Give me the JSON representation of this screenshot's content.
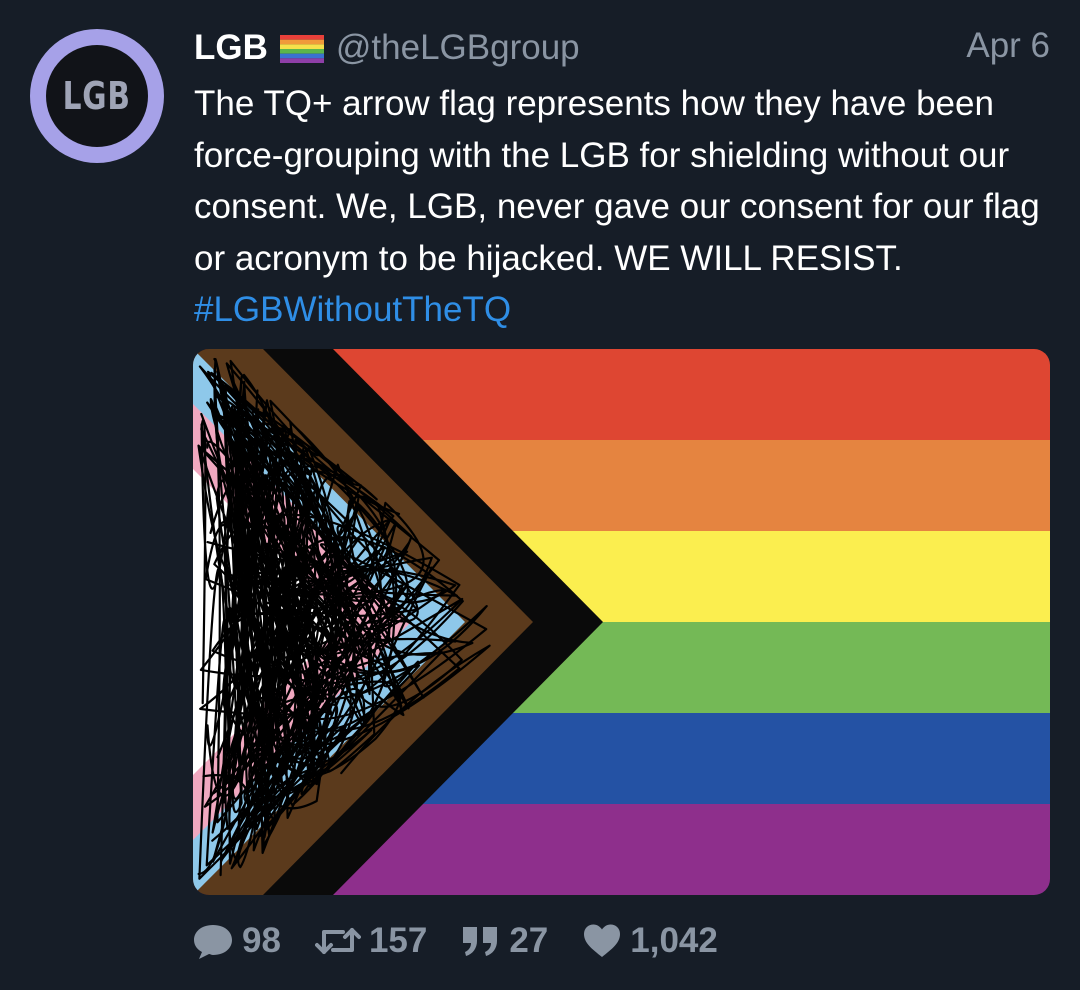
{
  "tweet": {
    "avatar_text": "LGB",
    "display_name": "LGB",
    "name_emoji": "rainbow-flag-icon",
    "handle": "@theLGBgroup",
    "date": "Apr 6",
    "text_main": "The TQ+ arrow flag represents how they have been force-grouping with the LGB for shielding without our consent. We, LGB, never gave our consent for our flag or acronym to be hijacked. WE WILL RESIST. ",
    "hashtag": "#LGBWithoutTheTQ",
    "media": {
      "description_icon": "progress-pride-flag-scribbled",
      "stripe_colors": [
        "#de4632",
        "#e58440",
        "#fbee4f",
        "#74b956",
        "#2452a4",
        "#8e2f8c"
      ]
    },
    "actions": {
      "replies": "98",
      "retweets": "157",
      "quotes": "27",
      "likes": "1,042"
    }
  },
  "colors": {
    "background": "#161d27",
    "text": "#ffffff",
    "muted": "#8a95a3",
    "link": "#2f8ee6",
    "avatar_ring": "#a6a1e8"
  }
}
